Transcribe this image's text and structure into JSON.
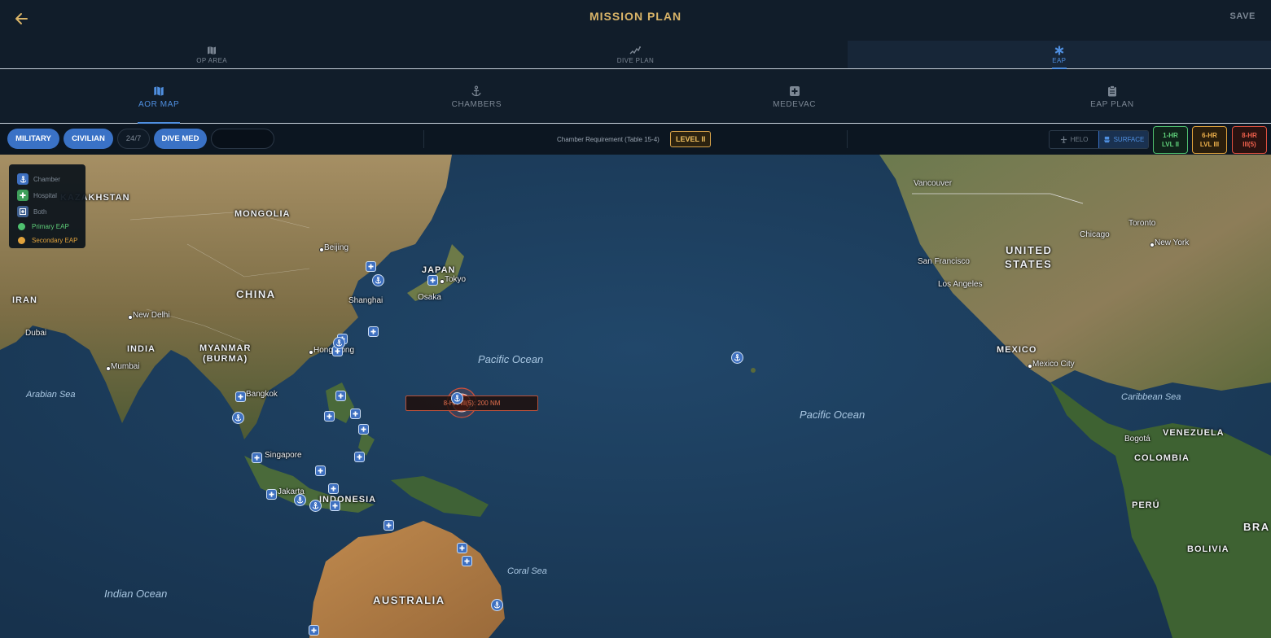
{
  "header": {
    "title": "MISSION PLAN",
    "save_label": "SAVE"
  },
  "tabs_primary": [
    {
      "label": "OP AREA",
      "icon": "map-icon"
    },
    {
      "label": "DIVE PLAN",
      "icon": "dive-path-icon"
    },
    {
      "label": "EAP",
      "icon": "medical-star-icon",
      "active": true
    }
  ],
  "tabs_secondary": [
    {
      "label": "AOR MAP",
      "icon": "map-icon",
      "active": true
    },
    {
      "label": "CHAMBERS",
      "icon": "anchor-icon"
    },
    {
      "label": "MEDEVAC",
      "icon": "medical-cross-icon"
    },
    {
      "label": "EAP PLAN",
      "icon": "clipboard-icon"
    }
  ],
  "filters": {
    "military": "MILITARY",
    "civilian": "CIVILIAN",
    "hours": "24/7",
    "dive_med": "DIVE MED",
    "chamber_requirement_label": "Chamber Requirement (Table 15-4)",
    "level": "LEVEL II",
    "modes": {
      "helo": "HELO",
      "surface": "SURFACE"
    },
    "time_windows": [
      {
        "line1": "1-HR",
        "line2": "LVL II",
        "color": "#4fc16f"
      },
      {
        "line1": "6-HR",
        "line2": "LVL III",
        "color": "#e0a23c"
      },
      {
        "line1": "8-HR",
        "line2": "III(5)",
        "color": "#e0513f"
      }
    ]
  },
  "legend": {
    "chamber": "Chamber",
    "hospital": "Hospital",
    "both": "Both",
    "primary": "Primary EAP",
    "secondary": "Secondary EAP"
  },
  "map": {
    "range_label": "8-HR III(5): 200 NM",
    "countries": {
      "kazakhstan": "KAZAKHSTAN",
      "mongolia": "MONGOLIA",
      "china": "CHINA",
      "iran": "IRAN",
      "india": "INDIA",
      "myanmar1": "MYANMAR",
      "myanmar2": "(BURMA)",
      "japan": "JAPAN",
      "indonesia": "INDONESIA",
      "australia": "AUSTRALIA",
      "us1": "UNITED",
      "us2": "STATES",
      "mexico": "MEXICO",
      "venezuela": "VENEZUELA",
      "colombia": "COLOMBIA",
      "peru": "PERÚ",
      "bolivia": "BOLIVIA",
      "brazil": "BRA"
    },
    "cities": {
      "beijing": "Beijing",
      "tokyo": "Tokyo",
      "osaka": "Osaka",
      "shanghai": "Shanghai",
      "newdelhi": "New Delhi",
      "dubai": "Dubai",
      "mumbai": "Mumbai",
      "hongkong": "Hong Kong",
      "bangkok": "Bangkok",
      "singapore": "Singapore",
      "jakarta": "Jakarta",
      "vancouver": "Vancouver",
      "sanfrancisco": "San Francisco",
      "losangeles": "Los Angeles",
      "chicago": "Chicago",
      "toronto": "Toronto",
      "newyork": "New York",
      "mexicocity": "Mexico City",
      "bogota": "Bogotá"
    },
    "oceans": {
      "arabian": "Arabian Sea",
      "pacific_w": "Pacific Ocean",
      "pacific_e": "Pacific Ocean",
      "caribbean": "Caribbean Sea",
      "coral": "Coral Sea",
      "indian": "Indian Ocean"
    }
  }
}
